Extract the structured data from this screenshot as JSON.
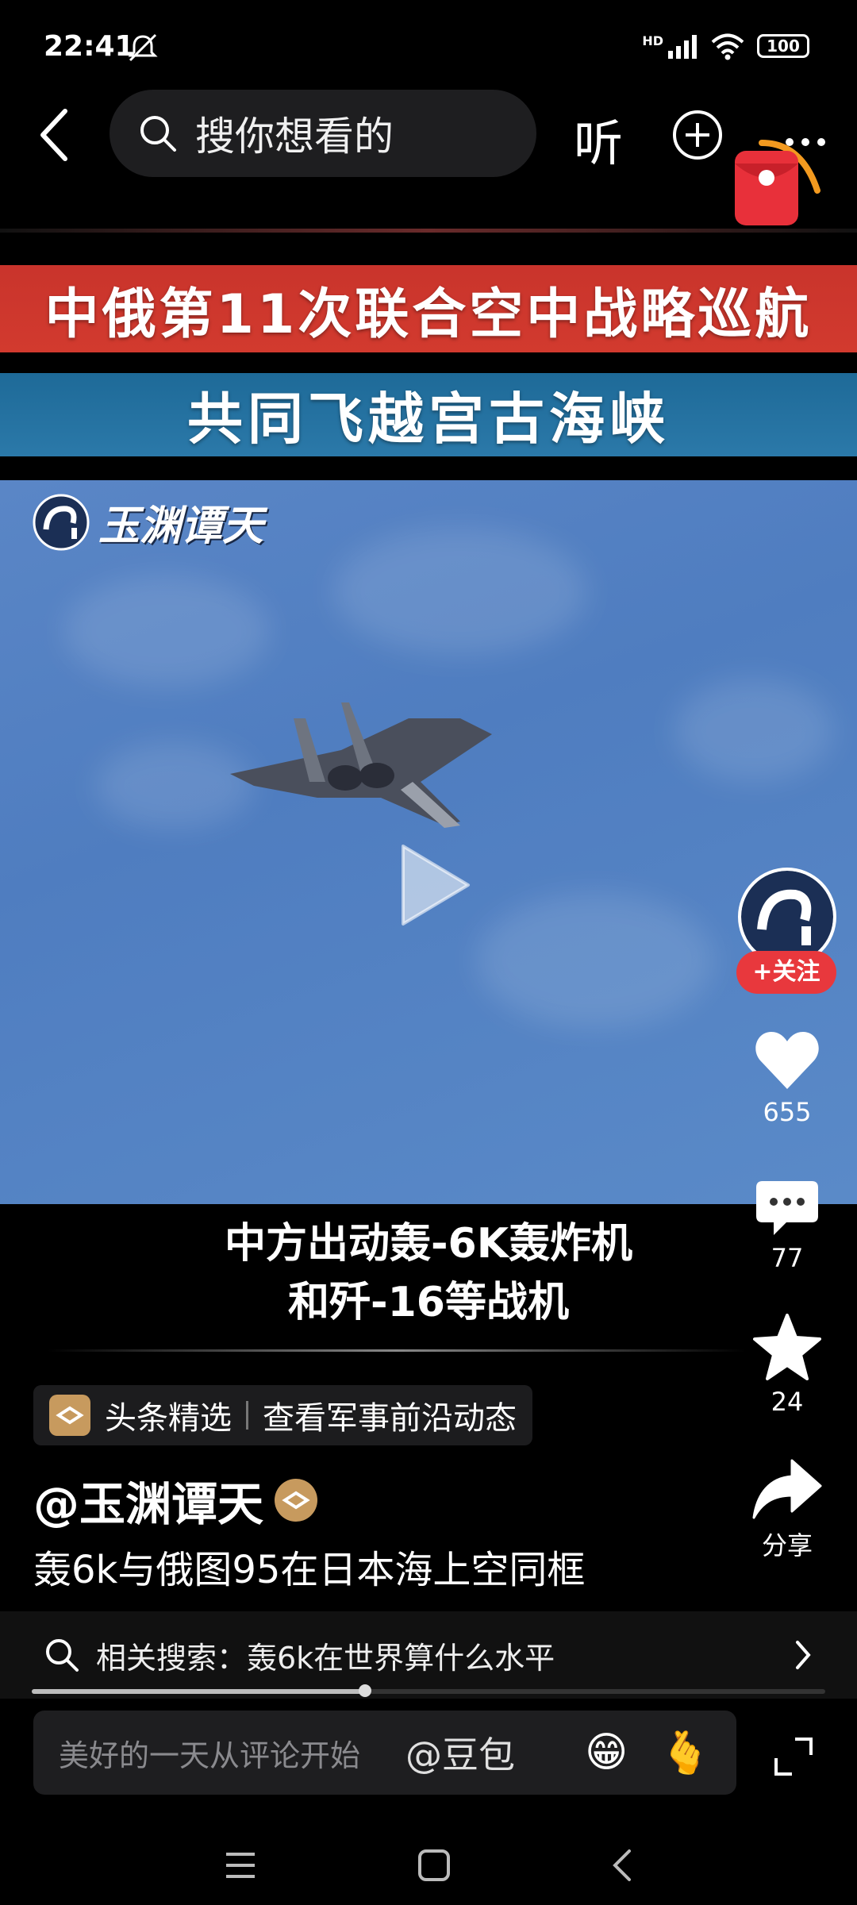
{
  "status_bar": {
    "time": "22:41",
    "network": "HD",
    "battery": "100"
  },
  "top_bar": {
    "search_placeholder": "搜你想看的",
    "listen_label": "听"
  },
  "banners": {
    "red": "中俄第11次联合空中战略巡航",
    "blue": "共同飞越宫古海峡"
  },
  "video": {
    "watermark": "玉渊谭天",
    "caption_line1": "中方出动轰-6K轰炸机",
    "caption_line2": "和歼-16等战机",
    "progress": 0.42
  },
  "right_rail": {
    "follow_label": "+关注",
    "like_count": "655",
    "comment_count": "77",
    "favorite_count": "24",
    "share_label": "分享"
  },
  "info": {
    "source_name": "头条精选",
    "source_action": "查看军事前沿动态",
    "author": "@玉渊谭天",
    "title": "轰6k与俄图95在日本海上空同框"
  },
  "related_search": {
    "label": "相关搜索：轰6k在世界算什么水平"
  },
  "comment_bar": {
    "placeholder": "美好的一天从评论开始",
    "mention": "@豆包",
    "emoji1": "😁",
    "emoji2": "🫰"
  },
  "colors": {
    "accent_red": "#e8383d",
    "gold": "#c79a5e",
    "banner_red": "#c9342c",
    "banner_blue": "#1e6a98"
  }
}
